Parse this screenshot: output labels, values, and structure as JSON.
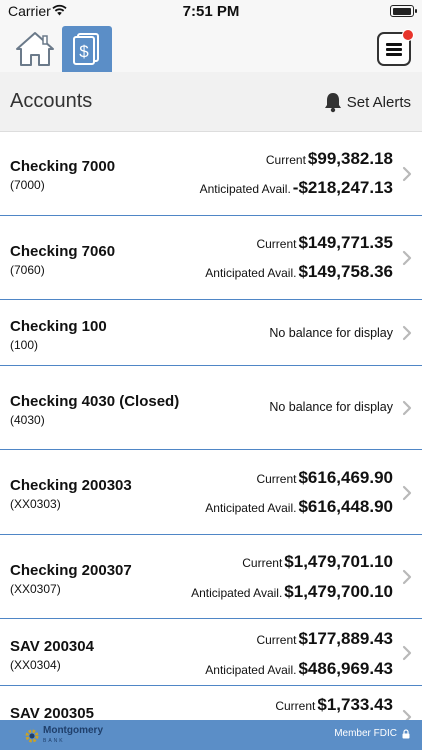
{
  "status_bar": {
    "carrier": "Carrier",
    "time": "7:51 PM"
  },
  "nav": {
    "home_icon": "home-icon",
    "accounts_icon": "dollar-document-icon",
    "menu_icon": "hamburger-menu-icon",
    "active_color": "#5b8ec7"
  },
  "header": {
    "title": "Accounts",
    "alerts_label": "Set Alerts"
  },
  "accounts": [
    {
      "name": "Checking 7000",
      "number": "(7000)",
      "current_label": "Current",
      "current": "$99,382.18",
      "avail_label": "Anticipated Avail.",
      "avail": "-$218,247.13"
    },
    {
      "name": "Checking 7060",
      "number": "(7060)",
      "current_label": "Current",
      "current": "$149,771.35",
      "avail_label": "Anticipated Avail.",
      "avail": "$149,758.36"
    },
    {
      "name": "Checking 100",
      "number": "(100)",
      "no_balance": "No balance for display"
    },
    {
      "name": "Checking 4030 (Closed)",
      "number": "(4030)",
      "no_balance": "No balance for display"
    },
    {
      "name": "Checking 200303",
      "number": "(XX0303)",
      "current_label": "Current",
      "current": "$616,469.90",
      "avail_label": "Anticipated Avail.",
      "avail": "$616,448.90"
    },
    {
      "name": "Checking 200307",
      "number": "(XX0307)",
      "current_label": "Current",
      "current": "$1,479,701.10",
      "avail_label": "Anticipated Avail.",
      "avail": "$1,479,700.10"
    },
    {
      "name": "SAV 200304",
      "number": "(XX0304)",
      "current_label": "Current",
      "current": "$177,889.43",
      "avail_label": "Anticipated Avail.",
      "avail": "$486,969.43"
    },
    {
      "name": "SAV 200305",
      "number": "",
      "current_label": "Current",
      "current": "$1,733.43"
    }
  ],
  "footer": {
    "brand": "Montgomery",
    "brand_sub": "BANK",
    "member": "Member FDIC",
    "color": "#5b8ec7"
  }
}
